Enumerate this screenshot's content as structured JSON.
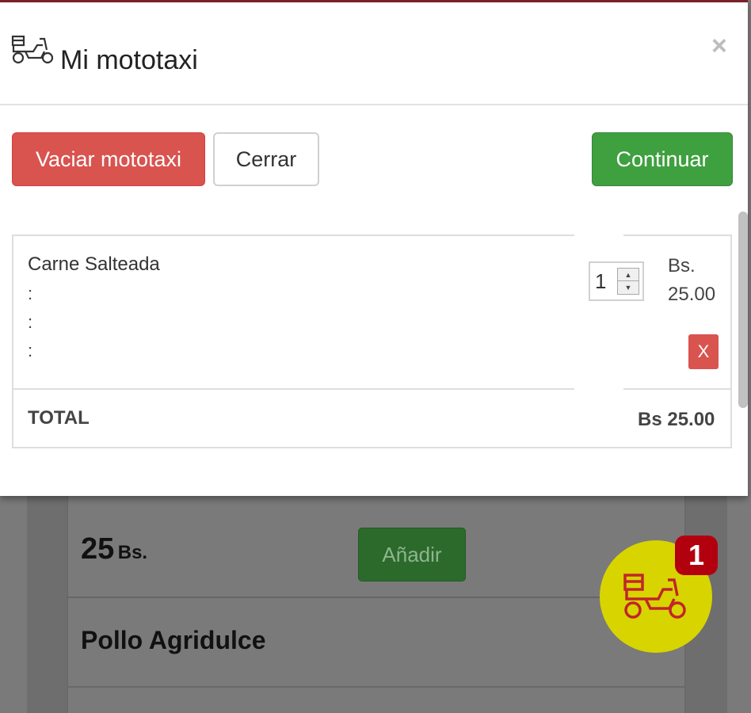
{
  "modal": {
    "title": "Mi mototaxi",
    "close_symbol": "×",
    "title_icon": "scooter-delivery-icon",
    "buttons": {
      "empty_label": "Vaciar mototaxi",
      "close_label": "Cerrar",
      "continue_label": "Continuar"
    },
    "cart": {
      "items": [
        {
          "name": "Carne Salteada",
          "details": [
            ":",
            ":",
            ":"
          ],
          "quantity": "1",
          "currency": "Bs.",
          "price": "25.00",
          "remove_label": "X"
        }
      ],
      "total_label": "TOTAL",
      "total_value": "Bs 25.00"
    }
  },
  "background": {
    "price_number": "25",
    "price_currency": "Bs.",
    "add_button_label": "Añadir",
    "next_dish": "Pollo Agridulce"
  },
  "cart_fab": {
    "icon": "scooter-delivery-icon",
    "badge_count": "1"
  },
  "colors": {
    "danger": "#d9534f",
    "success": "#3fa03f",
    "fab": "#d8d400",
    "badge": "#b3000f"
  }
}
